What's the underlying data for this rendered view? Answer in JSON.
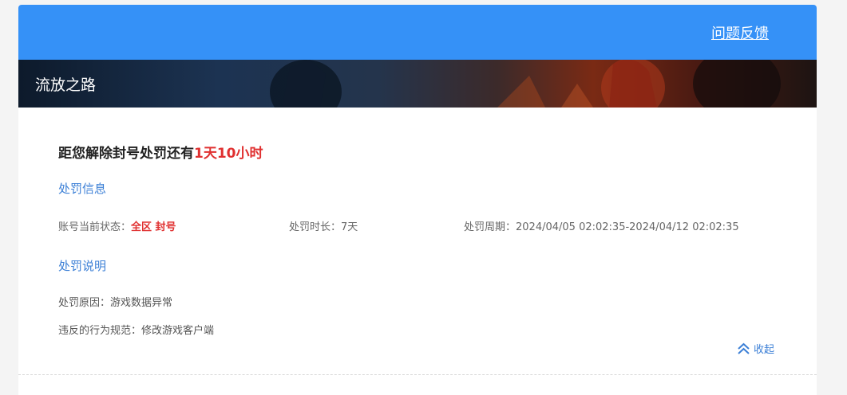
{
  "header": {
    "feedback_label": "问题反馈"
  },
  "banner": {
    "title": "流放之路"
  },
  "countdown": {
    "prefix": "距您解除封号处罚还有",
    "remaining": "1天10小时"
  },
  "penalty_info": {
    "title": "处罚信息",
    "status_label": "账号当前状态：",
    "status_value": "全区 封号",
    "duration_label": "处罚时长：",
    "duration_value": "7天",
    "period_label": "处罚周期：",
    "period_value": "2024/04/05 02:02:35-2024/04/12 02:02:35"
  },
  "penalty_desc": {
    "title": "处罚说明",
    "reason_label": "处罚原因：",
    "reason_value": "游戏数据异常",
    "rule_label": "违反的行为规范：",
    "rule_value": "修改游戏客户端"
  },
  "collapse": {
    "label": "收起",
    "icon": "double-chevron-up-icon"
  },
  "colors": {
    "header_bg": "#3591f7",
    "link_blue": "#3b7fd6",
    "highlight_red": "#e03030"
  }
}
